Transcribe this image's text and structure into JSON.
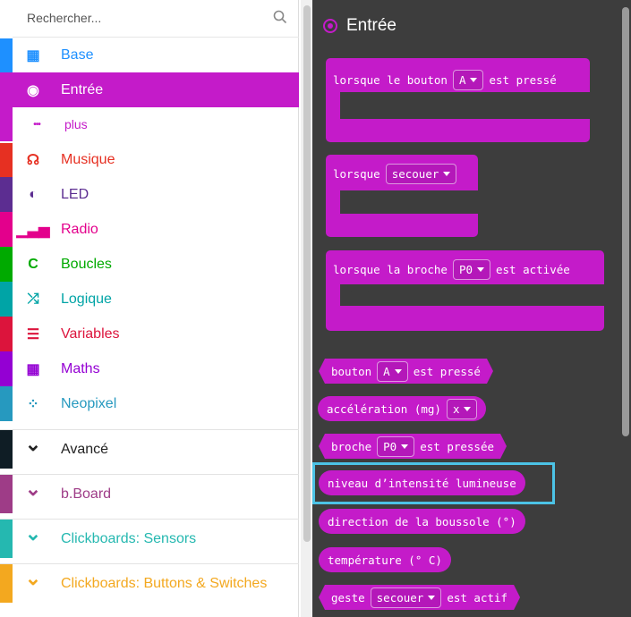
{
  "search": {
    "placeholder": "Rechercher...",
    "icon": "search-icon"
  },
  "categories": [
    {
      "label": "Base",
      "color": "#1e90ff",
      "icon": "grid-icon",
      "glyph": "▦"
    },
    {
      "label": "Entrée",
      "color": "#c41bc9",
      "icon": "target-icon",
      "glyph": "◉",
      "selected": true
    },
    {
      "label": "plus",
      "color": "#c41bc9",
      "icon": "more-icon",
      "glyph": "•••",
      "sub": true
    },
    {
      "label": "Musique",
      "color": "#e63022",
      "icon": "headphones-icon",
      "glyph": "☊"
    },
    {
      "label": "LED",
      "color": "#5c2d91",
      "icon": "toggle-icon",
      "glyph": "◐"
    },
    {
      "label": "Radio",
      "color": "#e3008c",
      "icon": "signal-icon",
      "glyph": "▁▃▅"
    },
    {
      "label": "Boucles",
      "color": "#00aa00",
      "icon": "loop-icon",
      "glyph": "C"
    },
    {
      "label": "Logique",
      "color": "#00a4a6",
      "icon": "shuffle-icon",
      "glyph": "⤮"
    },
    {
      "label": "Variables",
      "color": "#dc143c",
      "icon": "list-icon",
      "glyph": "☰"
    },
    {
      "label": "Maths",
      "color": "#9400d3",
      "icon": "calculator-icon",
      "glyph": "▦"
    },
    {
      "label": "Neopixel",
      "color": "#2699bf",
      "icon": "dots-circle-icon",
      "glyph": "⁘"
    },
    {
      "label": "Avancé",
      "color": "#0f1d25",
      "icon": "chevron-down-icon",
      "glyph": "⌄",
      "text_color": "#222"
    },
    {
      "label": "b.Board",
      "color": "#9e3c87",
      "icon": "chevron-down-icon",
      "glyph": "⌄"
    },
    {
      "label": "Clickboards: Sensors",
      "color": "#25b8b0",
      "icon": "chevron-down-icon",
      "glyph": "⌄"
    },
    {
      "label": "Clickboards: Buttons & Switches",
      "color": "#f3a81f",
      "icon": "chevron-down-icon",
      "glyph": "⌄"
    }
  ],
  "flyout": {
    "title": "Entrée",
    "accent": "#c41bc9",
    "blocks": {
      "on_button": {
        "prefix": "lorsque le bouton",
        "dropdown": "A",
        "suffix": "est pressé"
      },
      "on_shake": {
        "prefix": "lorsque",
        "dropdown": "secouer"
      },
      "on_pin": {
        "prefix": "lorsque la broche",
        "dropdown": "P0",
        "suffix": "est activée"
      },
      "button_pressed": {
        "prefix": "bouton",
        "dropdown": "A",
        "suffix": "est pressé"
      },
      "acceleration": {
        "prefix": "accélération (mg)",
        "dropdown": "x"
      },
      "pin_pressed": {
        "prefix": "broche",
        "dropdown": "P0",
        "suffix": "est pressée"
      },
      "light_level": {
        "label": "niveau d’intensité lumineuse"
      },
      "compass": {
        "label": "direction de la boussole (°)"
      },
      "temperature": {
        "label": "température (° C)"
      },
      "gesture": {
        "prefix": "geste",
        "dropdown": "secouer",
        "suffix": "est actif"
      }
    },
    "highlight_color": "#4cc3e6"
  }
}
